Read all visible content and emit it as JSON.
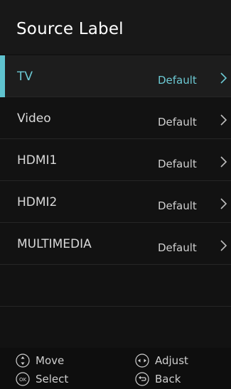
{
  "header": {
    "title": "Source Label"
  },
  "sources": [
    {
      "name": "TV",
      "value": "Default"
    },
    {
      "name": "Video",
      "value": "Default"
    },
    {
      "name": "HDMI1",
      "value": "Default"
    },
    {
      "name": "HDMI2",
      "value": "Default"
    },
    {
      "name": "MULTIMEDIA",
      "value": "Default"
    }
  ],
  "selected_index": 0,
  "colors": {
    "accent": "#5fc3cf",
    "background": "#121212"
  },
  "footer": {
    "move": "Move",
    "adjust": "Adjust",
    "select": "Select",
    "back": "Back",
    "ok_icon_text": "OK"
  }
}
